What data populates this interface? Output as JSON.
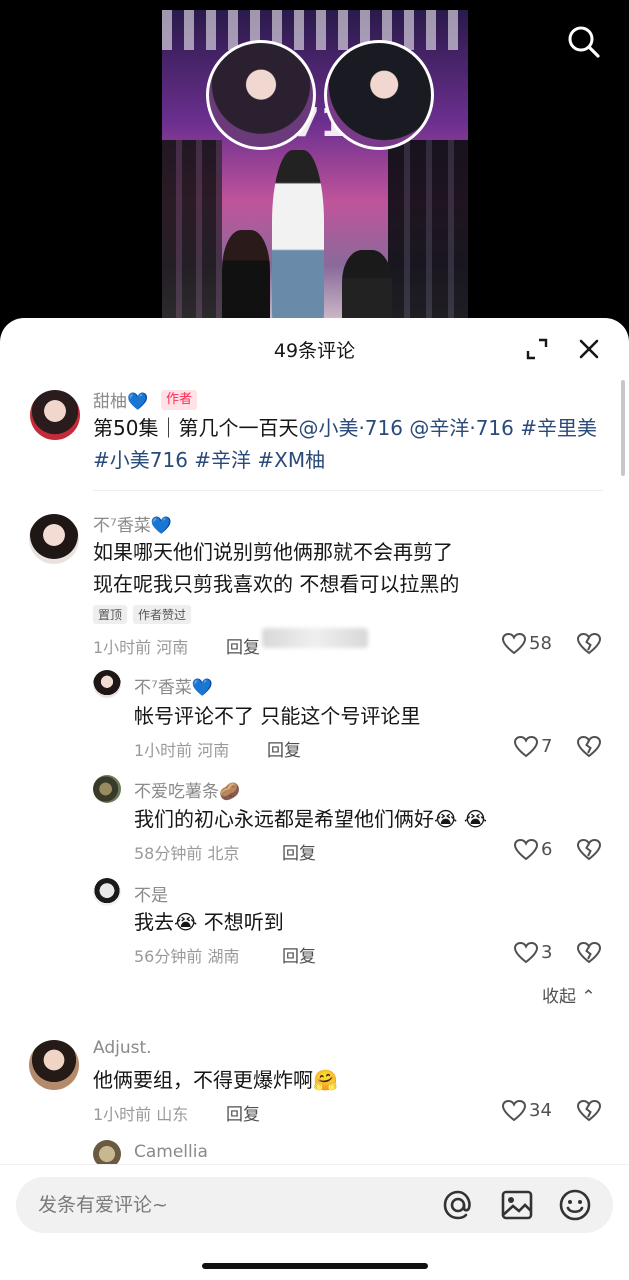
{
  "header": {
    "title": "49条评论"
  },
  "comments": {
    "author_post": {
      "name": "甜柚💙",
      "badge": "作者",
      "text_prefix": "第50集｜第几个一百天",
      "mention1": "@小美·716",
      "mention2": "@辛洋·716",
      "tag1": "#辛里美",
      "tag2": "#小美716",
      "tag3": "#辛洋",
      "tag4": "#XM柚"
    },
    "c1": {
      "name": "不⁷香菜💙",
      "line1": "如果哪天他们说别剪他俩那就不会再剪了",
      "line2": "现在呢我只剪我喜欢的 不想看可以拉黑的",
      "tag_pinned": "置顶",
      "tag_liked": "作者赞过",
      "time_loc": "1小时前 河南",
      "reply": "回复",
      "likes": "58"
    },
    "r1": {
      "name": "不⁷香菜💙",
      "text": "帐号评论不了 只能这个号评论里",
      "time_loc": "1小时前 河南",
      "reply": "回复",
      "likes": "7"
    },
    "r2": {
      "name": "不爱吃薯条🥔",
      "text": "我们的初心永远都是希望他们俩好😭 😭",
      "time_loc": "58分钟前 北京",
      "reply": "回复",
      "likes": "6"
    },
    "r3": {
      "name": "不是",
      "text": "我去😭 不想听到",
      "time_loc": "56分钟前 湖南",
      "reply": "回复",
      "likes": "3"
    },
    "collapse": "收起 ⌃",
    "c2": {
      "name": "Adjust.",
      "text": "他俩要组，不得更爆炸啊🤗",
      "time_loc": "1小时前 山东",
      "reply": "回复",
      "likes": "34"
    },
    "c3": {
      "name": "Camellia"
    }
  },
  "input": {
    "placeholder": "发条有爱评论~"
  },
  "icons": [
    "search-icon",
    "expand-icon",
    "close-icon",
    "heart-icon",
    "heart-break-icon",
    "at-icon",
    "image-icon",
    "emoji-icon"
  ],
  "colors": {
    "accent": "#fe2c55",
    "link": "#2a4a7a"
  }
}
